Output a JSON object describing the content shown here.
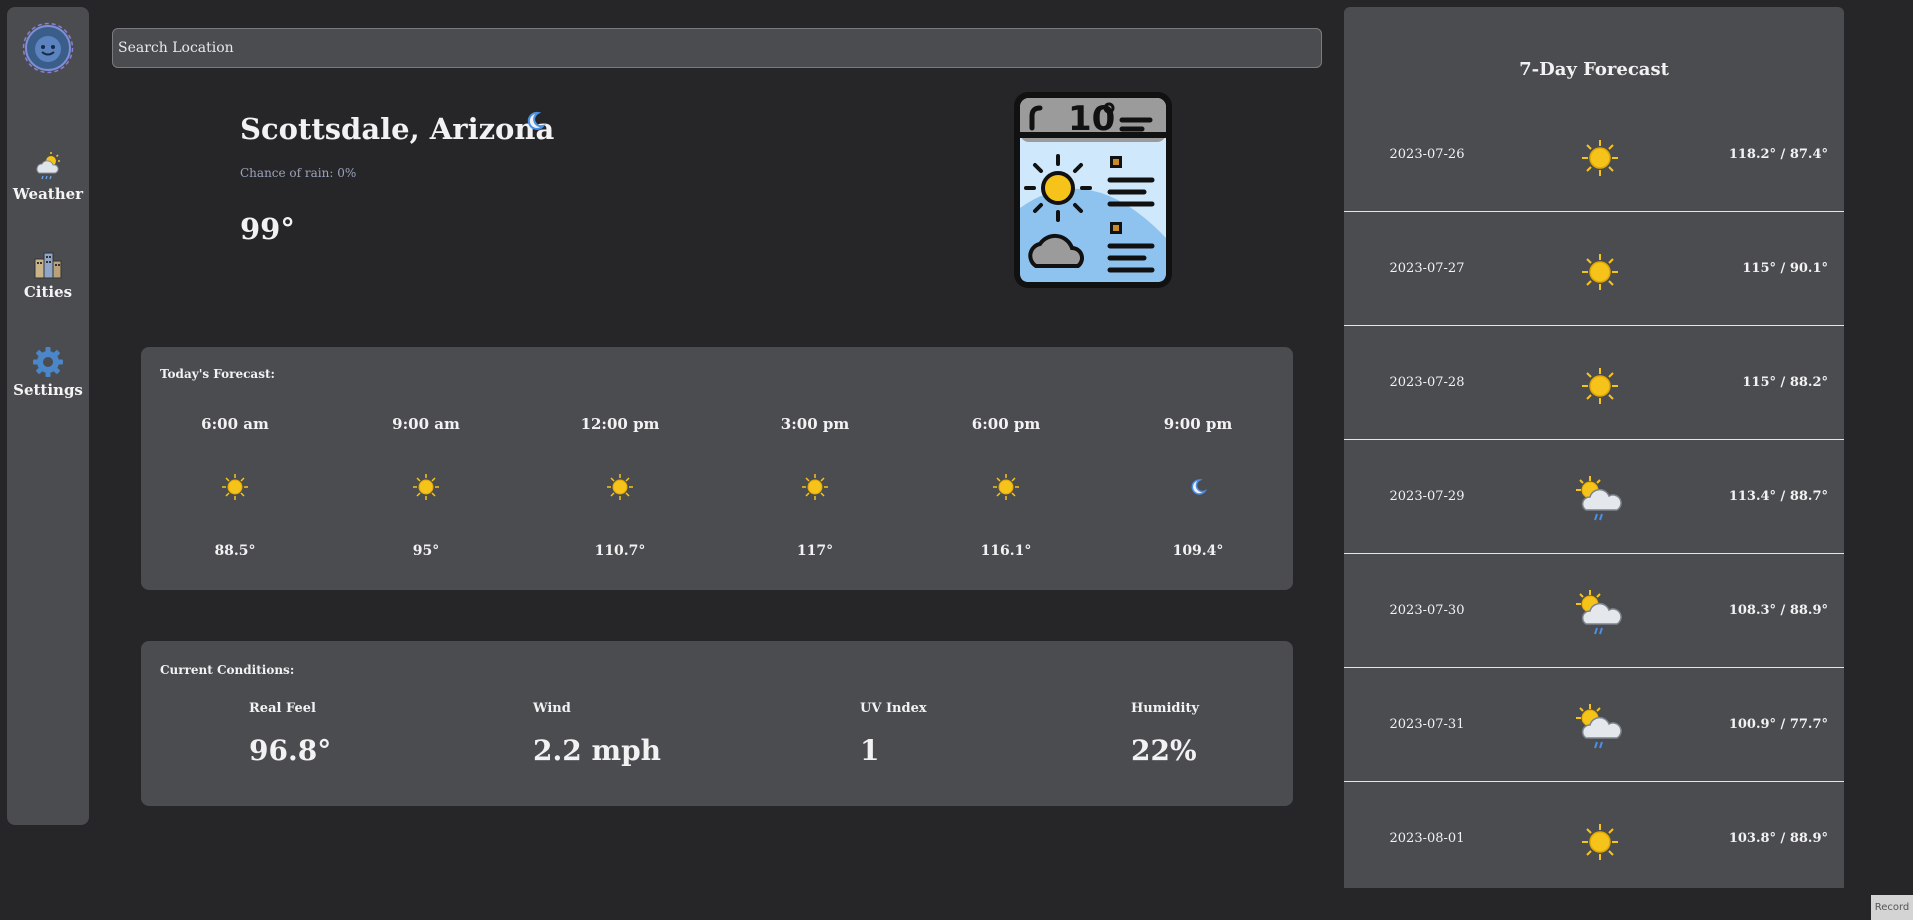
{
  "nav": {
    "items": [
      {
        "label": "Weather",
        "icon": "partly-cloudy-rain-icon"
      },
      {
        "label": "Cities",
        "icon": "city-buildings-icon"
      },
      {
        "label": "Settings",
        "icon": "gear-icon"
      }
    ]
  },
  "search": {
    "placeholder": "Search Location"
  },
  "current": {
    "city": "Scottsdale, Arizona",
    "rain_text": "Chance of rain: 0%",
    "temperature": "99°",
    "condition_icon": "moon-icon"
  },
  "today": {
    "title": "Today's Forecast:",
    "hours": [
      {
        "time": "6:00 am",
        "temp": "88.5°",
        "icon": "sun-icon"
      },
      {
        "time": "9:00 am",
        "temp": "95°",
        "icon": "sun-icon"
      },
      {
        "time": "12:00 pm",
        "temp": "110.7°",
        "icon": "sun-icon"
      },
      {
        "time": "3:00 pm",
        "temp": "117°",
        "icon": "sun-icon"
      },
      {
        "time": "6:00 pm",
        "temp": "116.1°",
        "icon": "sun-icon"
      },
      {
        "time": "9:00 pm",
        "temp": "109.4°",
        "icon": "moon-icon"
      }
    ]
  },
  "conditions": {
    "title": "Current Conditions:",
    "items": [
      {
        "label": "Real Feel",
        "value": "96.8°"
      },
      {
        "label": "Wind",
        "value": "2.2 mph"
      },
      {
        "label": "UV Index",
        "value": "1"
      },
      {
        "label": "Humidity",
        "value": "22%"
      }
    ]
  },
  "week": {
    "title": "7-Day Forecast",
    "days": [
      {
        "date": "2023-07-26",
        "range": "118.2° / 87.4°",
        "icon": "sun-icon"
      },
      {
        "date": "2023-07-27",
        "range": "115° / 90.1°",
        "icon": "sun-icon"
      },
      {
        "date": "2023-07-28",
        "range": "115° / 88.2°",
        "icon": "sun-icon"
      },
      {
        "date": "2023-07-29",
        "range": "113.4° / 88.7°",
        "icon": "sun-cloud-rain-icon"
      },
      {
        "date": "2023-07-30",
        "range": "108.3° / 88.9°",
        "icon": "sun-cloud-rain-icon"
      },
      {
        "date": "2023-07-31",
        "range": "100.9° / 77.7°",
        "icon": "sun-cloud-rain-icon"
      },
      {
        "date": "2023-08-01",
        "range": "103.8° / 88.9°",
        "icon": "sun-icon"
      }
    ]
  },
  "record": {
    "label": "Record"
  },
  "colors": {
    "background": "#262628",
    "panel": "#4b4c50",
    "sun": "#f6c31a",
    "moon": "#4a8fe8",
    "rain_text": "#9aa3bc"
  }
}
